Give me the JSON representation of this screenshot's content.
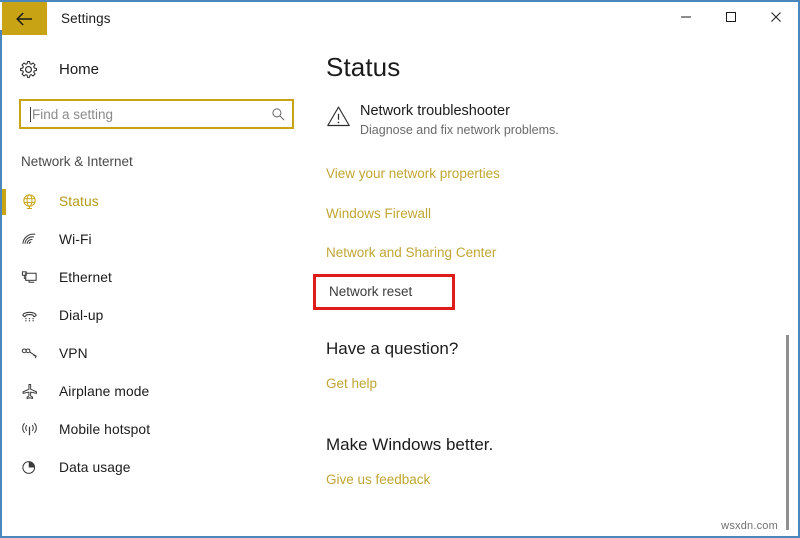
{
  "window": {
    "title": "Settings",
    "back_icon": "back-arrow-icon",
    "minimize_label": "–",
    "maximize_label": "□",
    "close_label": "✕",
    "border_color": "#4b86bd",
    "accent_color": "#c8a415"
  },
  "sidebar": {
    "home": {
      "label": "Home",
      "icon": "gear-icon"
    },
    "search": {
      "value": "",
      "placeholder": "Find a setting",
      "icon": "search-icon"
    },
    "group_title": "Network & Internet",
    "items": [
      {
        "label": "Status",
        "icon": "globe-icon",
        "selected": true
      },
      {
        "label": "Wi-Fi",
        "icon": "wifi-icon",
        "selected": false
      },
      {
        "label": "Ethernet",
        "icon": "ethernet-icon",
        "selected": false
      },
      {
        "label": "Dial-up",
        "icon": "dialup-phone-icon",
        "selected": false
      },
      {
        "label": "VPN",
        "icon": "vpn-icon",
        "selected": false
      },
      {
        "label": "Airplane mode",
        "icon": "airplane-icon",
        "selected": false
      },
      {
        "label": "Mobile hotspot",
        "icon": "hotspot-icon",
        "selected": false
      },
      {
        "label": "Data usage",
        "icon": "data-usage-pie-icon",
        "selected": false
      }
    ]
  },
  "main": {
    "page_title": "Status",
    "troubleshooter": {
      "icon": "warning-triangle-icon",
      "title": "Network troubleshooter",
      "subtitle": "Diagnose and fix network problems."
    },
    "links": {
      "view_properties": "View your network properties",
      "windows_firewall": "Windows Firewall",
      "network_sharing_center": "Network and Sharing Center",
      "network_reset": "Network reset"
    },
    "question_section": {
      "heading": "Have a question?",
      "link": "Get help"
    },
    "better_section": {
      "heading": "Make Windows better.",
      "link": "Give us feedback"
    },
    "highlight_color": "#e01b1b",
    "link_color": "#c0a634"
  },
  "watermark": "wsxdn.com"
}
